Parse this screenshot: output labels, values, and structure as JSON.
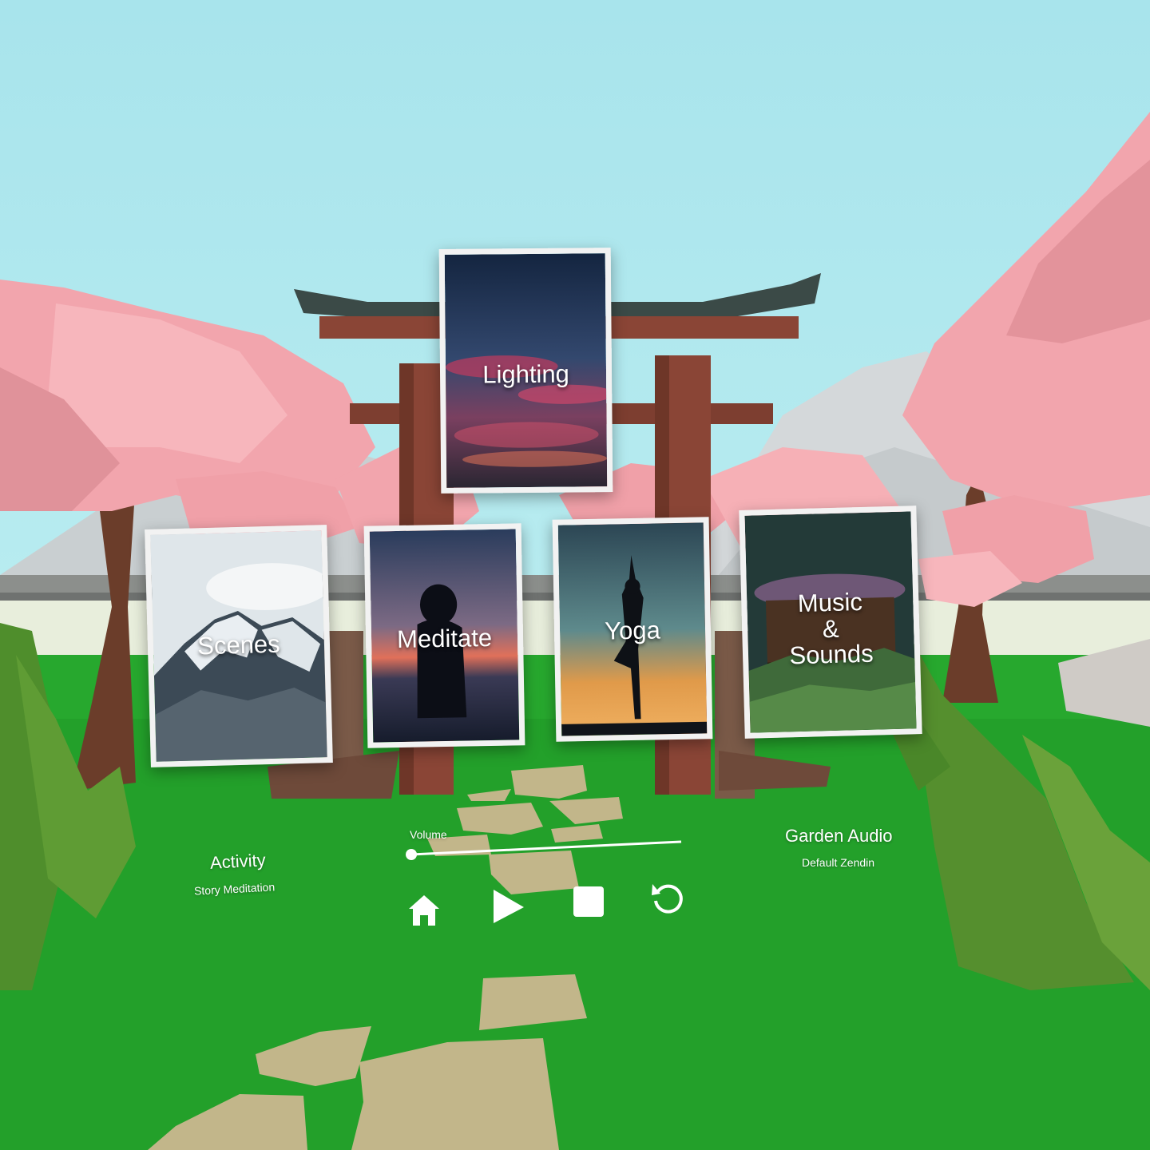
{
  "cards": {
    "lighting": "Lighting",
    "scenes": "Scenes",
    "meditate": "Meditate",
    "yoga": "Yoga",
    "music": [
      "Music",
      "&",
      "Sounds"
    ]
  },
  "activity": {
    "title": "Activity",
    "subtitle": "Story Meditation"
  },
  "audio": {
    "title": "Garden Audio",
    "subtitle": "Default Zendin"
  },
  "volume": {
    "label": "Volume",
    "level": 0.0
  },
  "controls": {
    "icons": [
      "home-icon",
      "play-icon",
      "stop-icon",
      "restart-icon"
    ]
  },
  "colors": {
    "sky": "#b3e8ee",
    "grass": "#23a02a",
    "blossom": "#f0a0a8",
    "gate": "#8a4536",
    "stone": "#c2b68a"
  }
}
